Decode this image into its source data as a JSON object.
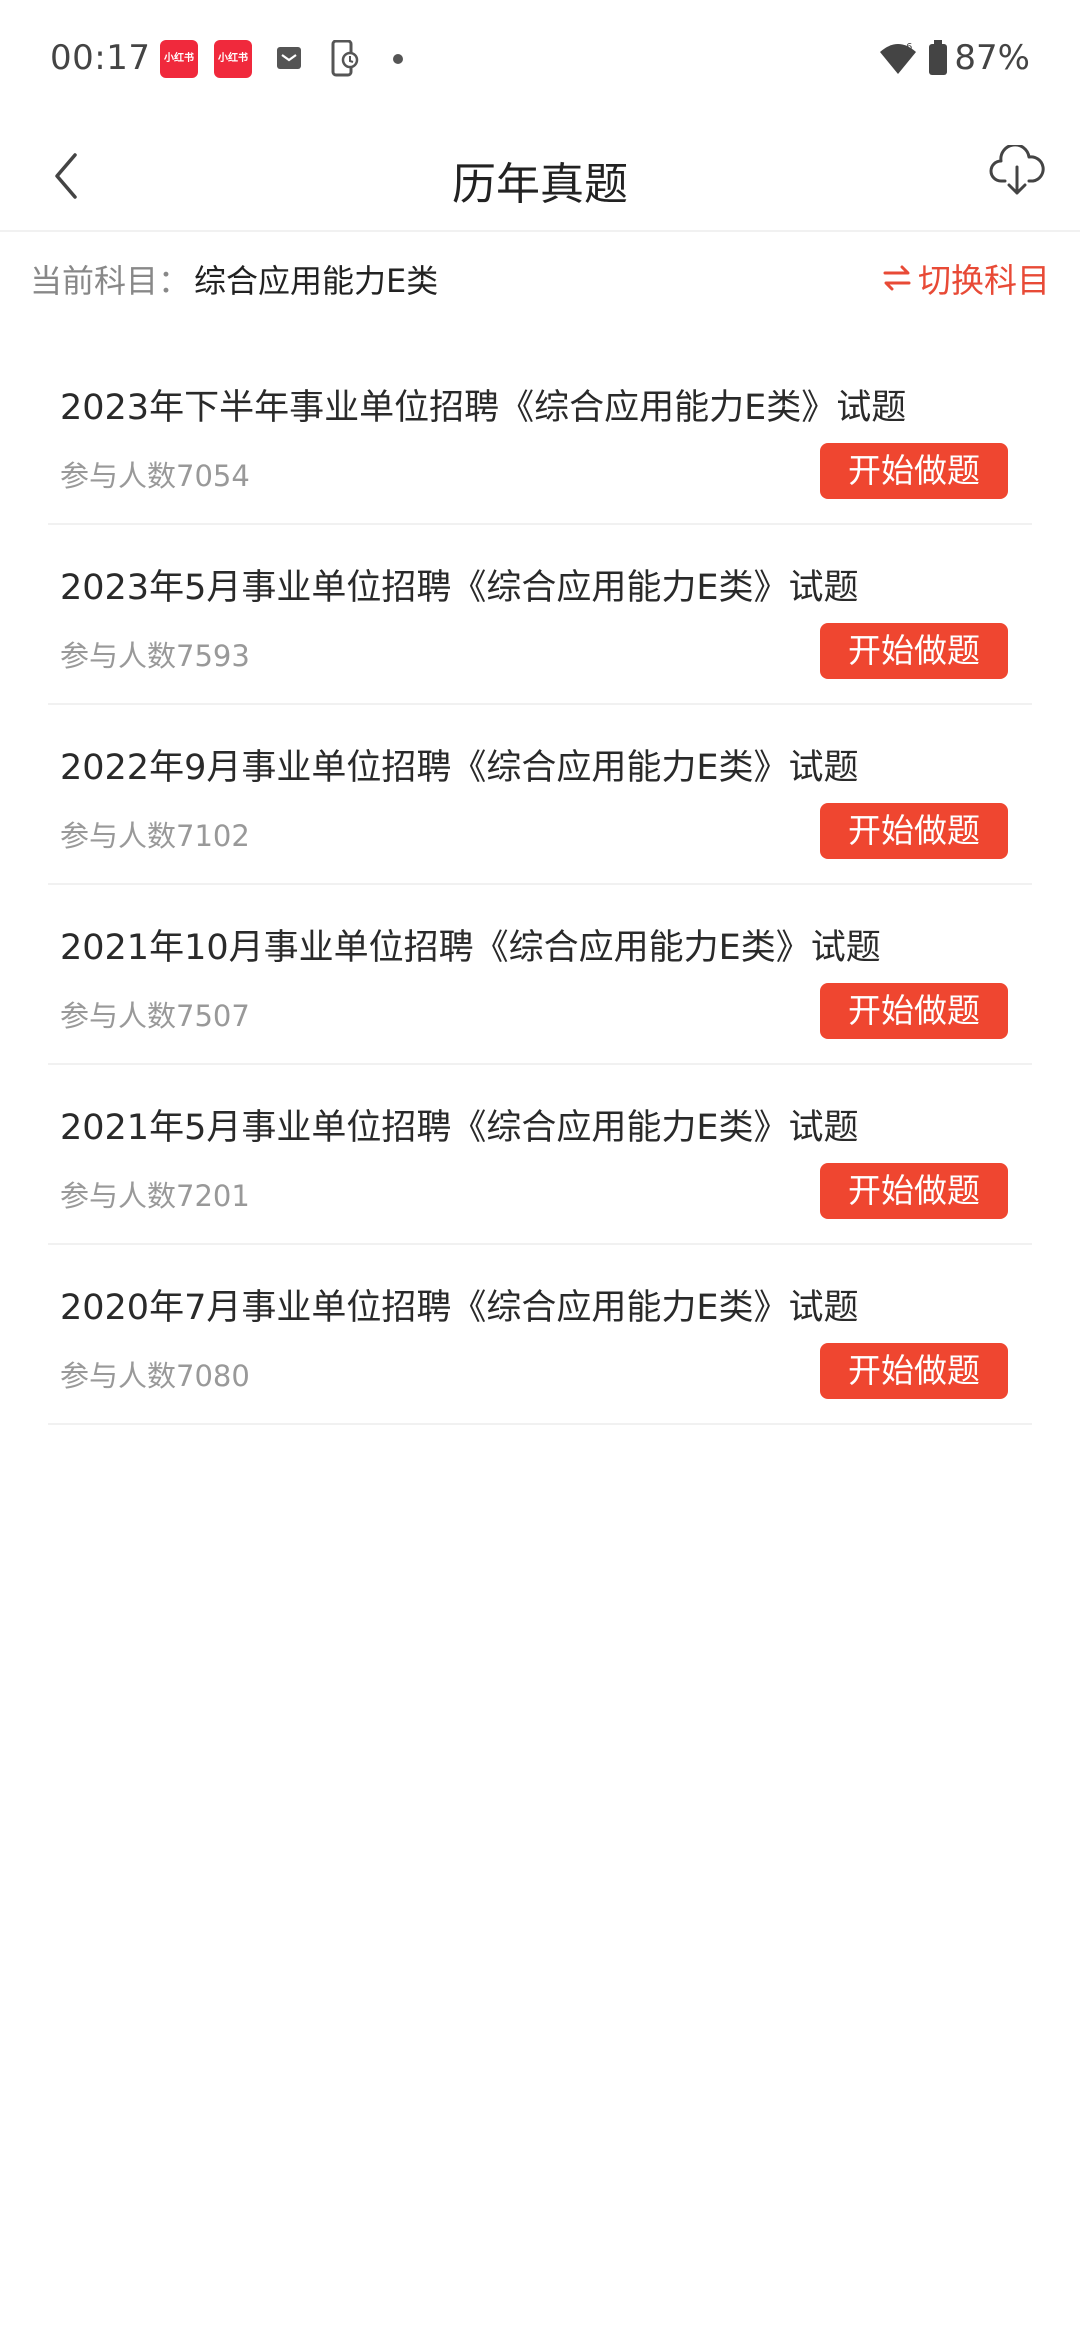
{
  "status_bar": {
    "time": "00:17",
    "notifications": [
      {
        "icon": "xiaohongshu-icon",
        "text": "小红书"
      },
      {
        "icon": "xiaohongshu-icon",
        "text": "小红书"
      },
      {
        "icon": "mail-icon"
      },
      {
        "icon": "phone-sync-icon"
      },
      {
        "icon": "dot-icon"
      }
    ],
    "battery": "87%",
    "colors": {
      "notification_badge": "#f0293c"
    }
  },
  "header": {
    "title": "历年真题",
    "back_icon": "chevron-left-icon",
    "download_icon": "cloud-download-icon"
  },
  "subject": {
    "label": "当前科目：",
    "value": "综合应用能力E类",
    "switch_label": "切换科目",
    "switch_icon": "swap-icon"
  },
  "exams": [
    {
      "title": "2023年下半年事业单位招聘《综合应用能力E类》试题",
      "participants": "参与人数7054",
      "button": "开始做题"
    },
    {
      "title": "2023年5月事业单位招聘《综合应用能力E类》试题",
      "participants": "参与人数7593",
      "button": "开始做题"
    },
    {
      "title": "2022年9月事业单位招聘《综合应用能力E类》试题",
      "participants": "参与人数7102",
      "button": "开始做题"
    },
    {
      "title": "2021年10月事业单位招聘《综合应用能力E类》试题",
      "participants": "参与人数7507",
      "button": "开始做题"
    },
    {
      "title": "2021年5月事业单位招聘《综合应用能力E类》试题",
      "participants": "参与人数7201",
      "button": "开始做题"
    },
    {
      "title": "2020年7月事业单位招聘《综合应用能力E类》试题",
      "participants": "参与人数7080",
      "button": "开始做题"
    }
  ],
  "colors": {
    "accent": "#e84a36",
    "button_bg": "#ef4630",
    "muted_text": "#999999"
  }
}
